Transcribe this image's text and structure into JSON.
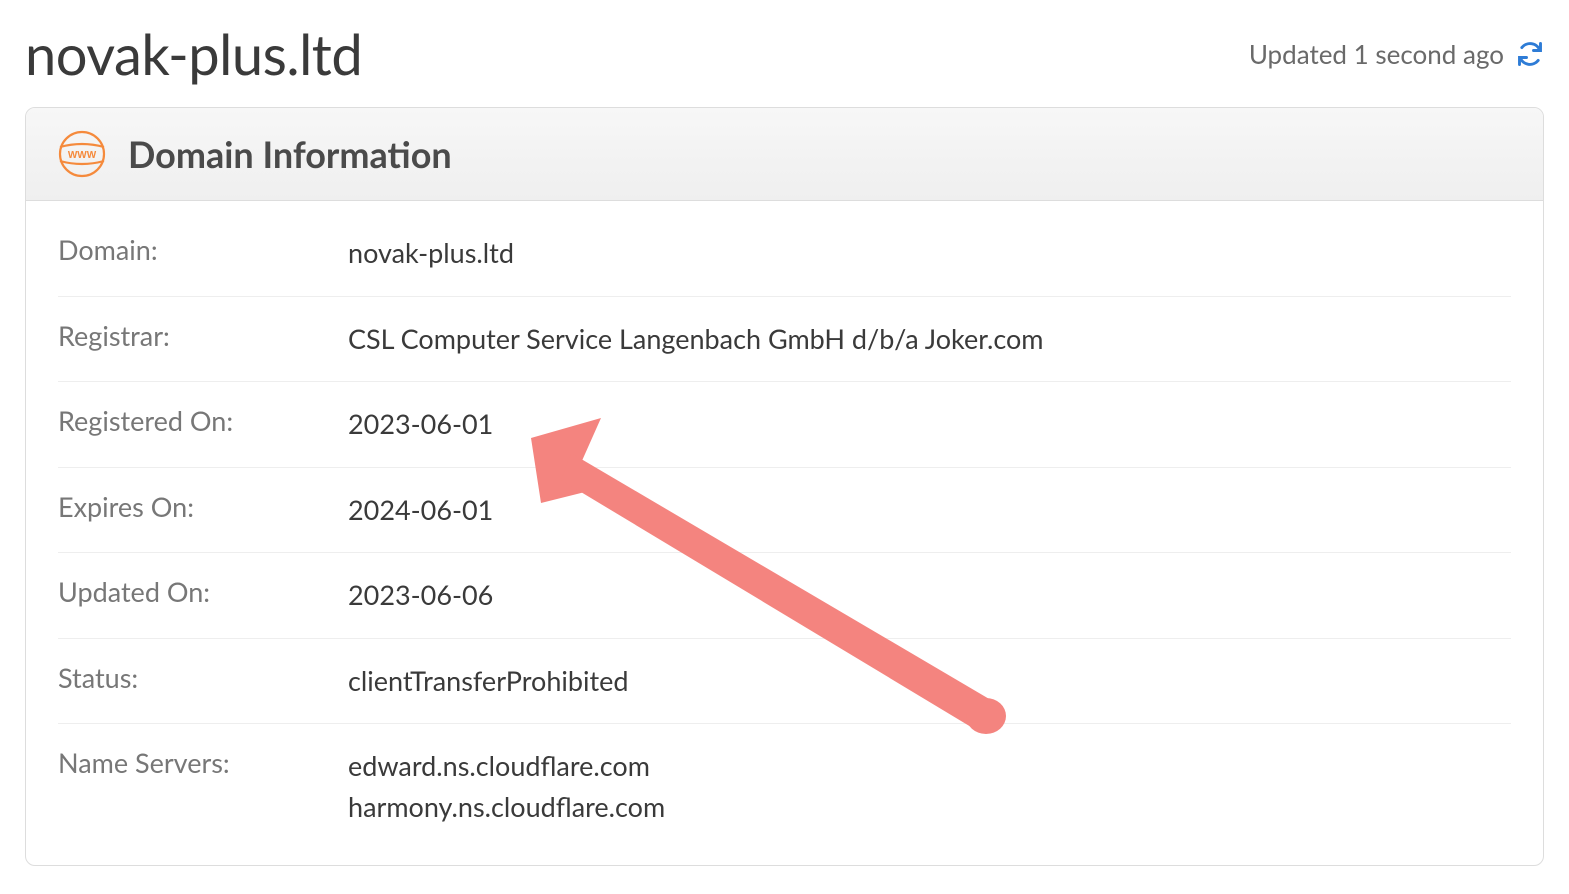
{
  "header": {
    "domain_title": "novak-plus.ltd",
    "updated_text": "Updated 1 second ago"
  },
  "panel": {
    "title": "Domain Information"
  },
  "info": {
    "domain_label": "Domain:",
    "domain_value": "novak-plus.ltd",
    "registrar_label": "Registrar:",
    "registrar_value": "CSL Computer Service Langenbach GmbH d/b/a Joker.com",
    "registered_on_label": "Registered On:",
    "registered_on_value": "2023-06-01",
    "expires_on_label": "Expires On:",
    "expires_on_value": "2024-06-01",
    "updated_on_label": "Updated On:",
    "updated_on_value": "2023-06-06",
    "status_label": "Status:",
    "status_value": "clientTransferProhibited",
    "name_servers_label": "Name Servers:",
    "name_servers_value_1": "edward.ns.cloudflare.com",
    "name_servers_value_2": "harmony.ns.cloudflare.com"
  },
  "colors": {
    "accent_orange": "#f58a3c",
    "refresh_blue": "#2e7cd6",
    "arrow_red": "#f4847f"
  }
}
